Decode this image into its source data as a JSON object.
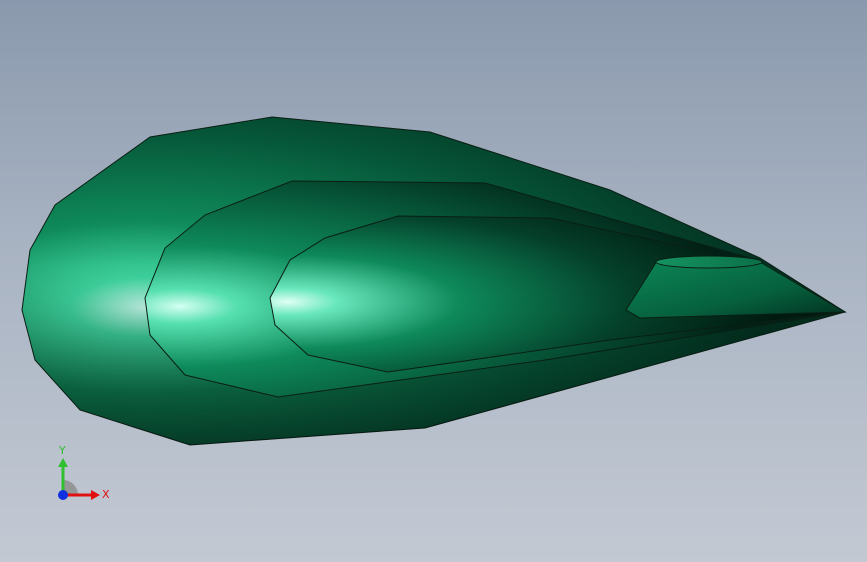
{
  "viewport": {
    "background_top": "#8a99ad",
    "background_bottom": "#c3c9d3"
  },
  "model": {
    "name": "teardrop-lofted-solid",
    "color": "#0d7a4f",
    "highlight_color": "#b8ffec",
    "edge_color": "#0a1f14"
  },
  "triad": {
    "x_label": "X",
    "y_label": "Y",
    "x_color": "#e01010",
    "y_color": "#2fbf2f",
    "z_color": "#1030e0"
  }
}
